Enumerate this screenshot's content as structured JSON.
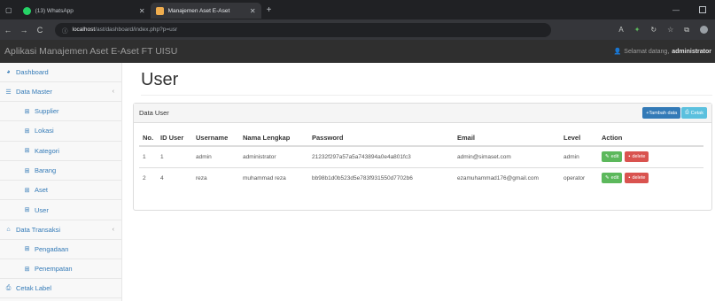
{
  "browser": {
    "tabs": [
      {
        "title": "(13) WhatsApp",
        "icon_color": "#25d366"
      },
      {
        "title": "Manajemen Aset E-Aset",
        "icon_color": "#f0ad4e"
      }
    ],
    "new_tab": "+",
    "url_host": "localhost",
    "url_path": "/ast/dashboard/index.php?p=usr",
    "back": "←",
    "forward": "→",
    "reload": "C",
    "info": "ⓘ"
  },
  "app": {
    "brand": "Aplikasi Manajemen Aset E-Aset FT UISU",
    "welcome_prefix": "Selamat datang,",
    "welcome_user": "administrator"
  },
  "sidebar": {
    "items": [
      {
        "label": "Dashboard",
        "icon": "dashboard-icon"
      },
      {
        "label": "Data Master",
        "icon": "list-icon",
        "arrow": "‹"
      },
      {
        "label": "Supplier",
        "icon": "table-icon"
      },
      {
        "label": "Lokasi",
        "icon": "table-icon"
      },
      {
        "label": "Kategori",
        "icon": "table-icon"
      },
      {
        "label": "Barang",
        "icon": "table-icon"
      },
      {
        "label": "Aset",
        "icon": "table-icon"
      },
      {
        "label": "User",
        "icon": "table-icon"
      },
      {
        "label": "Data Transaksi",
        "icon": "bank-icon",
        "arrow": "‹"
      },
      {
        "label": "Pengadaan",
        "icon": "table-icon"
      },
      {
        "label": "Penempatan",
        "icon": "table-icon"
      },
      {
        "label": "Cetak Label",
        "icon": "print-icon"
      }
    ]
  },
  "main": {
    "title": "User",
    "panel_title": "Data User",
    "add_label": "+Tambah data",
    "print_label": "Cetak",
    "columns": [
      "No.",
      "ID User",
      "Username",
      "Nama Lengkap",
      "Password",
      "Email",
      "Level",
      "Action"
    ],
    "rows": [
      [
        "1",
        "1",
        "admin",
        "administrator",
        "21232f297a57a5a743894a0e4a801fc3",
        "admin@simaset.com",
        "admin"
      ],
      [
        "2",
        "4",
        "reza",
        "muhammad reza",
        "bb98b1d0b523d5e783f931550d7702b6",
        "ezamuhammad176@gmail.com",
        "operator"
      ]
    ],
    "edit_label": "edit",
    "delete_label": "delete"
  }
}
